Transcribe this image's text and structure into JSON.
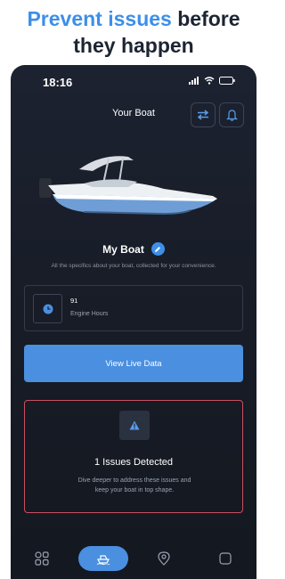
{
  "promo": {
    "line1_accent": "Prevent issues",
    "line1_rest": " before",
    "line2": "they happen"
  },
  "status_bar": {
    "time": "18:16"
  },
  "header": {
    "title": "Your Boat"
  },
  "boat": {
    "name": "My Boat",
    "description": "All the specifics about your boat, collected for your convenience."
  },
  "engine_hours": {
    "value": "91",
    "label": "Engine Hours"
  },
  "live_data_button": {
    "label": "View Live Data"
  },
  "issues": {
    "title": "1 Issues Detected",
    "description": "Dive deeper to address these issues and keep your boat in top shape."
  },
  "bottom_nav": {
    "items": [
      {
        "icon": "grid-icon",
        "active": false
      },
      {
        "icon": "boat-icon",
        "active": true
      },
      {
        "icon": "location-pin-icon",
        "active": false
      },
      {
        "icon": "square-icon",
        "active": false
      }
    ]
  },
  "colors": {
    "accent": "#4a8fe0",
    "alert": "#c95061",
    "background": "#181d28"
  }
}
